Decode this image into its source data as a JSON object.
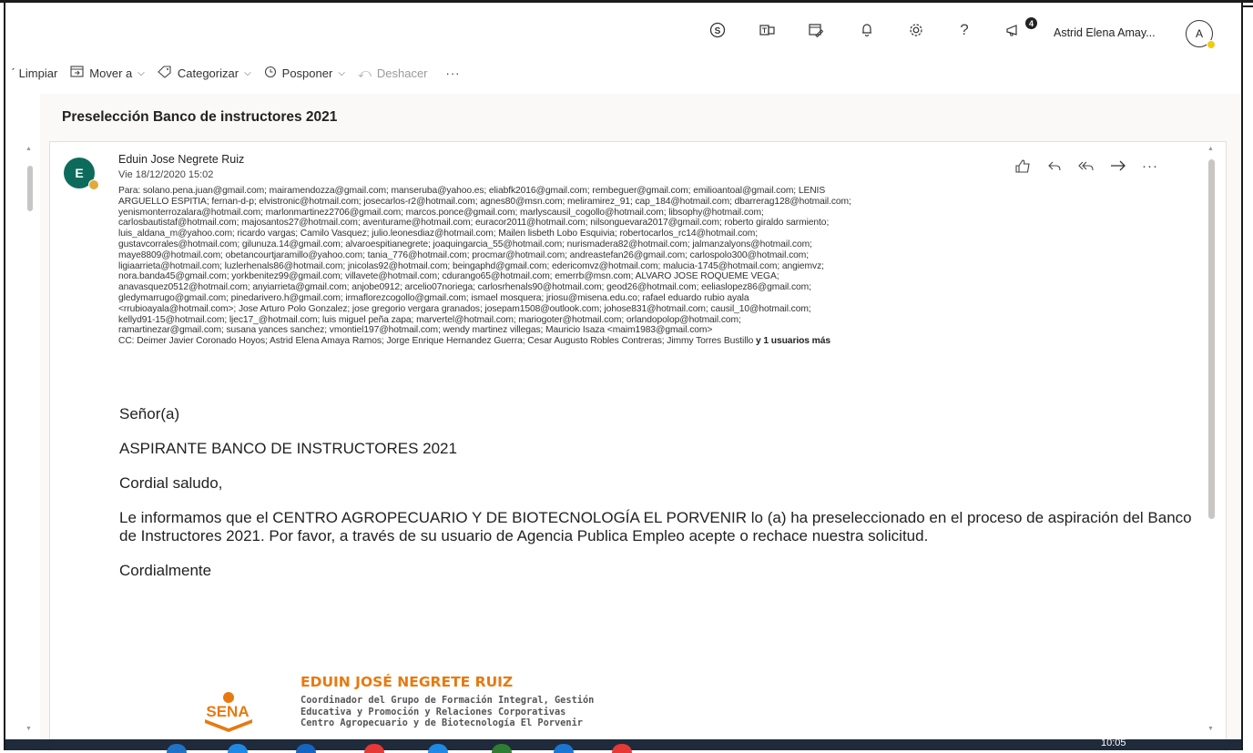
{
  "topbar": {
    "icons": [
      "skype-icon",
      "teams-icon",
      "calendar-icon",
      "bell-icon",
      "gear-icon",
      "help-icon",
      "megaphone-icon"
    ],
    "notification_count": "4",
    "user_name": "Astrid Elena Amay...",
    "avatar_initial": "A",
    "help_glyph": "?"
  },
  "commands": {
    "clear": "Limpiar",
    "move_to": "Mover a",
    "categorize": "Categorizar",
    "snooze": "Posponer",
    "undo": "Deshacer",
    "more": "···"
  },
  "message": {
    "subject": "Preselección Banco de instructores 2021",
    "sender_initial": "E",
    "sender_name": "Eduin Jose Negrete Ruiz",
    "date": "Vie 18/12/2020 15:02",
    "to_label": "Para:",
    "to_lines": [
      "solano.pena.juan@gmail.com; mairamendozza@gmail.com; manseruba@yahoo.es; eliabfk2016@gmail.com; rembeguer@gmail.com; emilioantoal@gmail.com; LENIS",
      "ARGUELLO ESPITIA; fernan-d-p; elvistronic@hotmail.com; josecarlos-r2@hotmail.com; agnes80@msn.com; meliramirez_91; cap_184@hotmail.com; dbarrerag128@hotmail.com;",
      "yenismonterrozalara@hotmail.com; marlonmartinez2706@gmail.com; marcos.ponce@gmail.com; marlyscausil_cogollo@hotmail.com; libsophy@hotmail.com;",
      "carlosbautistaf@hotmail.com; majosantos27@hotmail.com; aventurame@hotmail.com; euracor2011@hotmail.com; nilsonguevara2017@gmail.com; roberto giraldo sarmiento;",
      "luis_aldana_m@yahoo.com; ricardo vargas; Camilo Vasquez; julio.leonesdiaz@hotmail.com; Mailen lisbeth Lobo Esquivia; robertocarlos_rc14@hotmail.com;",
      "gustavcorrales@hotmail.com; gilunuza.14@gmail.com; alvaroespitianegrete; joaquingarcia_55@hotmail.com; nurismadera82@hotmail.com; jalmanzalyons@hotmail.com;",
      "maye8809@hotmail.com; obetancourtjaramillo@yahoo.com; tania_776@hotmail.com; procmar@hotmail.com; andreastefan26@gmail.com; carlospolo300@hotmail.com;",
      "ligiaarrieta@hotmail.com; luzlerhenals86@hotmail.com; jnicolas92@hotmail.com; beingaphd@gmail.com; edericomvz@hotmail.com; malucia-1745@hotmail.com; angiemvz;",
      "nora.banda45@gmail.com; yorkbenitez99@gmail.com; villavete@hotmail.com; cdurango65@hotmail.com; emerrb@msn.com; ALVARO JOSE ROQUEME VEGA;",
      "anavasquez0512@hotmail.com; anyiarrieta@gmail.com; anjobe0912; arcelio07noriega; carlosrhenals90@hotmail.com; geod26@hotmail.com; eeliaslopez86@gmail.com;",
      "gledymarrugo@gmail.com; pinedarivero.h@gmail.com; irmaflorezcogollo@gmail.com; ismael mosquera; jriosu@misena.edu.co; rafael eduardo rubio ayala",
      "<rrubioayala@hotmail.com>; Jose Arturo Polo Gonzalez; jose gregorio vergara granados; josepam1508@outlook.com; johose831@hotmail.com; causil_10@hotmail.com;",
      "kellyd91-15@hotmail.com; ljec17_@hotmail.com; luis miguel peña zapa; marvertel@hotmail.com; mariogoter@hotmail.com; orlandopolop@hotmail.com;",
      "ramartinezar@gmail.com; susana yances sanchez; vmontiel197@hotmail.com; wendy martinez villegas; Mauricio Isaza <maim1983@gmail.com>"
    ],
    "cc_label": "CC:",
    "cc": "Deimer Javier Coronado Hoyos; Astrid Elena Amaya Ramos; Jorge Enrique Hernandez Guerra; Cesar Augusto Robles Contreras; Jimmy Torres Bustillo",
    "cc_more": "y 1 usuarios más",
    "body": {
      "greeting": "Señor(a)",
      "addressee": "ASPIRANTE BANCO DE INSTRUCTORES  2021",
      "salutation": "Cordial saludo,",
      "paragraph": "Le informamos que el CENTRO AGROPECUARIO Y DE BIOTECNOLOGÍA EL PORVENIR lo (a) ha preseleccionado  en el proceso de aspiración del  Banco de Instructores 2021.  Por favor, a través de su usuario de Agencia Publica Empleo acepte o rechace nuestra  solicitud.",
      "closing": "Cordialmente"
    },
    "signature": {
      "name": "EDUIN JOSÉ NEGRETE RUIZ",
      "lines": [
        "Coordinador del Grupo de Formación Integral, Gestión",
        "Educativa y Promoción y Relaciones Corporativas",
        "Centro Agropecuario y de Biotecnología El Porvenir"
      ],
      "logo_text": "SENA"
    }
  },
  "taskbar": {
    "time": "10:05"
  },
  "colors": {
    "accent": "#0078d4",
    "sender_avatar": "#0d6b5b",
    "sena_orange": "#e8790f",
    "taskbar": "#1f2a3a"
  }
}
